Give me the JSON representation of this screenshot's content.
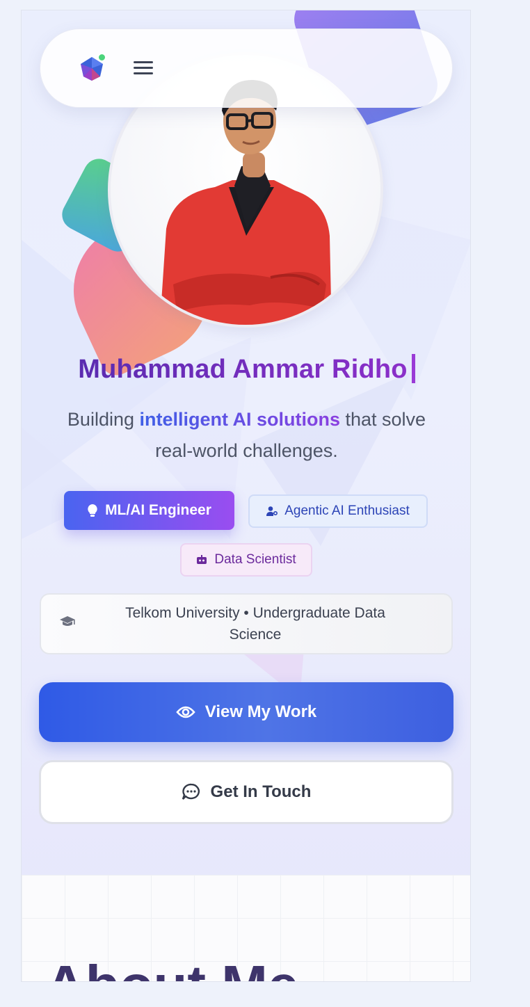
{
  "brand": {
    "logo_icon": "gem-logo-icon",
    "online_status_color": "#4cd47c"
  },
  "nav": {
    "menu_icon": "hamburger-menu-icon"
  },
  "profile": {
    "name": "Muhammad Ammar Ridho",
    "photo": "profile-photo"
  },
  "tagline": {
    "prefix": "Building ",
    "highlight": "intelligent AI solutions",
    "suffix": " that solve real-world challenges."
  },
  "roles": [
    {
      "label": "ML/AI Engineer",
      "icon": "lightbulb-icon"
    },
    {
      "label": "Agentic AI Enthusiast",
      "icon": "user-cog-icon"
    },
    {
      "label": "Data Scientist",
      "icon": "robot-icon"
    }
  ],
  "education": {
    "icon": "graduation-cap-icon",
    "text": "Telkom University • Undergraduate Data Science"
  },
  "actions": {
    "primary": {
      "label": "View My Work",
      "icon": "eye-icon"
    },
    "secondary": {
      "label": "Get In Touch",
      "icon": "chat-bubble-icon"
    }
  },
  "next_section": {
    "title": "About Me"
  },
  "colors": {
    "accent_blue": "#2f5ae6",
    "accent_purple": "#8b2fc9",
    "chip_blue_bg": "#e8effd",
    "chip_purple_bg": "#f7eaf9"
  }
}
